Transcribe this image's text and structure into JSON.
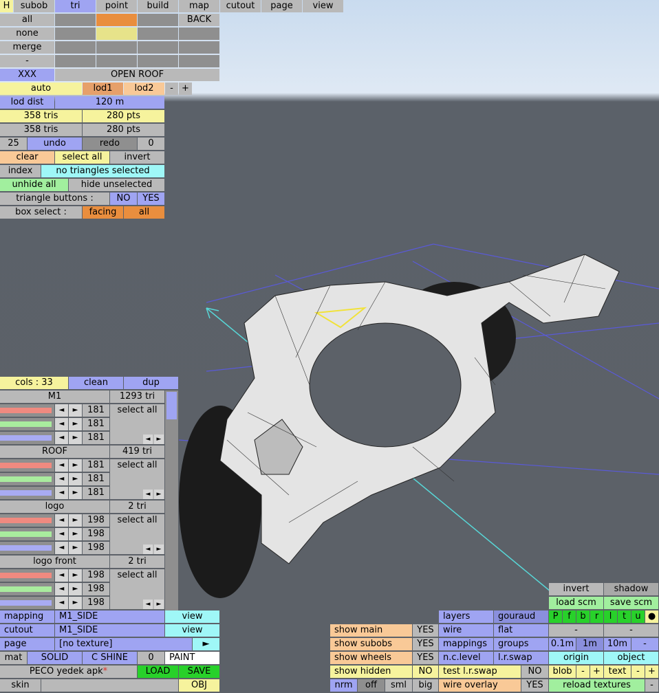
{
  "tabs": [
    "H",
    "subob",
    "tri",
    "point",
    "build",
    "map",
    "cutout",
    "page",
    "view"
  ],
  "top_grid": {
    "all": "all",
    "back": "BACK",
    "none": "none",
    "merge": "merge",
    "dash": "-",
    "xxx": "XXX",
    "open_roof": "OPEN ROOF"
  },
  "lod": {
    "auto": "auto",
    "lod1": "lod1",
    "lod2": "lod2",
    "minus": "-",
    "plus": "+",
    "lod_dist": "lod dist",
    "dist_value": "120 m"
  },
  "stats": {
    "tris1": "358 tris",
    "pts1": "280 pts",
    "tris2": "358 tris",
    "pts2": "280 pts"
  },
  "undo": {
    "count": "25",
    "undo": "undo",
    "redo": "redo",
    "redo_count": "0"
  },
  "select": {
    "clear": "clear",
    "select_all": "select all",
    "invert": "invert",
    "index": "index",
    "status": "no triangles selected",
    "unhide_all": "unhide all",
    "hide_unselected": "hide unselected",
    "tri_buttons": "triangle buttons :",
    "no": "NO",
    "yes": "YES",
    "box_select": "box select :",
    "facing": "facing",
    "all": "all"
  },
  "materials": {
    "cols": "cols : 33",
    "clean": "clean",
    "dup": "dup",
    "items": [
      {
        "name": "M1",
        "tris": "1293 tri",
        "values": [
          "181",
          "181",
          "181"
        ],
        "select": "select all",
        "levels": [
          0.95,
          0.95,
          0.95,
          0.95
        ]
      },
      {
        "name": "ROOF",
        "tris": "419 tri",
        "values": [
          "181",
          "181",
          "181"
        ],
        "select": "select all",
        "levels": [
          0.95,
          0.95,
          0.95,
          0.95
        ]
      },
      {
        "name": "logo",
        "tris": "2 tri",
        "values": [
          "198",
          "198",
          "198"
        ],
        "select": "select all",
        "levels": [
          0.95,
          0.95,
          0.95,
          0.95
        ]
      },
      {
        "name": "logo front",
        "tris": "2 tri",
        "values": [
          "198",
          "198",
          "198"
        ],
        "select": "select all",
        "levels": [
          0.95,
          0.95,
          0.95,
          0.95
        ]
      }
    ],
    "arrow_left": "◄",
    "arrow_right": "►"
  },
  "bottom_left": {
    "mapping": "mapping",
    "mapping_val": "M1_SIDE",
    "view1": "view",
    "cutout": "cutout",
    "cutout_val": "M1_SIDE",
    "view2": "view",
    "page": "page",
    "page_val": "[no texture]",
    "play": "►",
    "mat": "mat",
    "solid": "SOLID",
    "cshine": "C SHINE",
    "zero": "0",
    "paint": "PAINT",
    "file_name": "PECO yedek apk",
    "star": "*",
    "load": "LOAD",
    "save": "SAVE",
    "skin": "skin",
    "obj": "OBJ"
  },
  "bottom_mid": {
    "show_main": "show main",
    "show_subobs": "show subobs",
    "show_wheels": "show wheels",
    "show_hidden": "show hidden",
    "yes1": "YES",
    "yes2": "YES",
    "yes3": "YES",
    "no1": "NO",
    "nrm": "nrm",
    "off": "off",
    "sml": "sml",
    "big": "big"
  },
  "bottom_right": {
    "invert": "invert",
    "shadow": "shadow",
    "load_scm": "load scm",
    "save_scm": "save scm",
    "layers": "layers",
    "gouraud": "gouraud",
    "wire": "wire",
    "flat": "flat",
    "mappings": "mappings",
    "groups": "groups",
    "nclevel": "n.c.level",
    "lrswap": "l.r.swap",
    "test_lrswap": "test l.r.swap",
    "no": "NO",
    "wire_overlay": "wire overlay",
    "yes": "YES",
    "letters": [
      "P",
      "f",
      "b",
      "r",
      "l",
      "t",
      "u",
      "●"
    ],
    "dash1": "-",
    "dash2": "-",
    "m01": "0.1m",
    "m1": "1m",
    "m10": "10m",
    "mminus": "-",
    "origin": "origin",
    "object": "object",
    "blob": "blob",
    "bminus": "-",
    "bplus": "+",
    "text": "text",
    "tminus": "-",
    "tplus": "+",
    "reload": "reload textures",
    "rminus": "-"
  },
  "colors": {
    "lavender": "#9fa4f2",
    "yellow": "#f6f39d",
    "orange": "#e98e3e",
    "peach": "#f9c997",
    "cyan": "#9ff7f7",
    "green": "#a1ef9e",
    "bright_green": "#28d12a",
    "gray": "#b9b9b9",
    "bar_red": "#f08a80",
    "bar_green": "#a9ec9e",
    "bar_blue": "#a8abf2",
    "bar_gray": "#b8b8b8"
  }
}
